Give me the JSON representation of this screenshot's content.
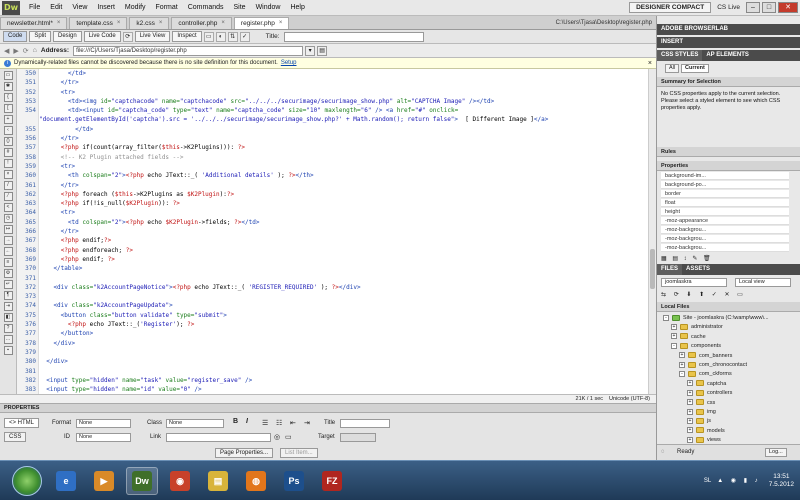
{
  "app": {
    "logo": "Dw",
    "menus": [
      "File",
      "Edit",
      "View",
      "Insert",
      "Modify",
      "Format",
      "Commands",
      "Site",
      "Window",
      "Help"
    ],
    "workspace": "DESIGNER COMPACT",
    "cs_live": "CS Live",
    "win_min": "–",
    "win_max": "□",
    "win_close": "✕"
  },
  "tabs": [
    {
      "label": "newsletter.html*",
      "active": false
    },
    {
      "label": "template.css",
      "active": false
    },
    {
      "label": "k2.css",
      "active": false
    },
    {
      "label": "controller.php",
      "active": false
    },
    {
      "label": "register.php",
      "active": true
    }
  ],
  "doc_path": "C:\\Users\\Tjasa\\Desktop\\register.php",
  "viewbar": {
    "code": "Code",
    "split": "Split",
    "design": "Design",
    "live_code": "Live Code",
    "live_view": "Live View",
    "inspect": "Inspect",
    "title_label": "Title:"
  },
  "address": {
    "label": "Address:",
    "value": "file:///C|/Users/Tjasa/Desktop/register.php"
  },
  "infobar": {
    "text": "Dynamically-related files cannot be discovered because there is no site definition for this document.",
    "link": "Setup"
  },
  "code_lines": [
    {
      "n": "350",
      "t": "<span class=\"k\">        &lt;/td&gt;</span>"
    },
    {
      "n": "351",
      "t": "<span class=\"k\">      &lt;/tr&gt;</span>"
    },
    {
      "n": "352",
      "t": "<span class=\"k\">      &lt;tr&gt;</span>"
    },
    {
      "n": "353",
      "t": "<span class=\"k\">        &lt;td&gt;&lt;img</span> <span class=\"a\">id=</span><span class=\"s\">\"captchacode\"</span> <span class=\"a\">name=</span><span class=\"s\">\"captchacode\"</span> <span class=\"a\">src=</span><span class=\"s\">\"../../../securimage/securimage_show.php\"</span> <span class=\"a\">alt=</span><span class=\"s\">\"CAPTCHA Image\"</span> <span class=\"k\">/&gt;&lt;/td&gt;</span>"
    },
    {
      "n": "354",
      "t": "<span class=\"k\">        &lt;td&gt;&lt;input</span> <span class=\"a\">id=</span><span class=\"s\">\"captcha_code\"</span> <span class=\"a\">type=</span><span class=\"s\">\"text\"</span> <span class=\"a\">name=</span><span class=\"s\">\"captcha_code\"</span> <span class=\"a\">size=</span><span class=\"s\">\"10\"</span> <span class=\"a\">maxlength=</span><span class=\"s\">\"6\"</span> <span class=\"k\">/&gt; &lt;a</span> <span class=\"a\">href=</span><span class=\"s\">\"#\"</span> <span class=\"a\">onclick=</span>\n<span class=\"s\">\"document.getElementById('captcha').src = '../../../securimage/securimage_show.php?' + Math.random(); return false\"</span><span class=\"k\">&gt;</span>  [ Different Image ]<span class=\"k\">&lt;/a&gt;</span>",
      "wrap": true
    },
    {
      "n": "355",
      "t": "<span class=\"k\">          &lt;/td&gt;</span>"
    },
    {
      "n": "356",
      "t": "<span class=\"k\">      &lt;/tr&gt;</span>"
    },
    {
      "n": "357",
      "t": "      <span class=\"p\">&lt;?php</span> if(count(array_filter(<span class=\"p\">$this</span>-&gt;K2Plugins))): <span class=\"p\">?&gt;</span>"
    },
    {
      "n": "358",
      "t": "<span class=\"c\">      &lt;!-- K2 Plugin attached fields --&gt;</span>"
    },
    {
      "n": "359",
      "t": "<span class=\"k\">      &lt;tr&gt;</span>"
    },
    {
      "n": "360",
      "t": "<span class=\"k\">        &lt;th</span> <span class=\"a\">colspan=</span><span class=\"s\">\"2\"</span><span class=\"k\">&gt;</span><span class=\"p\">&lt;?php</span> echo JText::_( <span class=\"s\">'Additional details'</span> ); <span class=\"p\">?&gt;</span><span class=\"k\">&lt;/th&gt;</span>"
    },
    {
      "n": "361",
      "t": "<span class=\"k\">      &lt;/tr&gt;</span>"
    },
    {
      "n": "362",
      "t": "      <span class=\"p\">&lt;?php</span> foreach (<span class=\"p\">$this</span>-&gt;K2Plugins as <span class=\"p\">$K2Plugin</span>):<span class=\"p\">?&gt;</span>"
    },
    {
      "n": "363",
      "t": "      <span class=\"p\">&lt;?php</span> if(!is_null(<span class=\"p\">$K2Plugin</span>)): <span class=\"p\">?&gt;</span>"
    },
    {
      "n": "364",
      "t": "<span class=\"k\">      &lt;tr&gt;</span>"
    },
    {
      "n": "365",
      "t": "<span class=\"k\">        &lt;td</span> <span class=\"a\">colspan=</span><span class=\"s\">\"2\"</span><span class=\"k\">&gt;</span><span class=\"p\">&lt;?php</span> echo <span class=\"p\">$K2Plugin</span>-&gt;fields; <span class=\"p\">?&gt;</span><span class=\"k\">&lt;/td&gt;</span>"
    },
    {
      "n": "366",
      "t": "<span class=\"k\">      &lt;/tr&gt;</span>"
    },
    {
      "n": "367",
      "t": "      <span class=\"p\">&lt;?php</span> endif;<span class=\"p\">?&gt;</span>"
    },
    {
      "n": "368",
      "t": "      <span class=\"p\">&lt;?php</span> endforeach; <span class=\"p\">?&gt;</span>"
    },
    {
      "n": "369",
      "t": "      <span class=\"p\">&lt;?php</span> endif; <span class=\"p\">?&gt;</span>"
    },
    {
      "n": "370",
      "t": "<span class=\"k\">    &lt;/table&gt;</span>"
    },
    {
      "n": "371",
      "t": ""
    },
    {
      "n": "372",
      "t": "<span class=\"k\">    &lt;div</span> <span class=\"a\">class=</span><span class=\"s\">\"k2AccountPageNotice\"</span><span class=\"k\">&gt;</span><span class=\"p\">&lt;?php</span> echo JText::_( <span class=\"s\">'REGISTER_REQUIRED'</span> ); <span class=\"p\">?&gt;</span><span class=\"k\">&lt;/div&gt;</span>"
    },
    {
      "n": "373",
      "t": ""
    },
    {
      "n": "374",
      "t": "<span class=\"k\">    &lt;div</span> <span class=\"a\">class=</span><span class=\"s\">\"k2AccountPageUpdate\"</span><span class=\"k\">&gt;</span>"
    },
    {
      "n": "375",
      "t": "<span class=\"k\">      &lt;button</span> <span class=\"a\">class=</span><span class=\"s\">\"button validate\"</span> <span class=\"a\">type=</span><span class=\"s\">\"submit\"</span><span class=\"k\">&gt;</span>"
    },
    {
      "n": "376",
      "t": "        <span class=\"p\">&lt;?php</span> echo JText::_(<span class=\"s\">'Register'</span>); <span class=\"p\">?&gt;</span>"
    },
    {
      "n": "377",
      "t": "<span class=\"k\">      &lt;/button&gt;</span>"
    },
    {
      "n": "378",
      "t": "<span class=\"k\">    &lt;/div&gt;</span>"
    },
    {
      "n": "379",
      "t": ""
    },
    {
      "n": "380",
      "t": "<span class=\"k\">  &lt;/div&gt;</span>"
    },
    {
      "n": "381",
      "t": ""
    },
    {
      "n": "382",
      "t": "<span class=\"k\">  &lt;input</span> <span class=\"a\">type=</span><span class=\"s\">\"hidden\"</span> <span class=\"a\">name=</span><span class=\"s\">\"task\"</span> <span class=\"a\">value=</span><span class=\"s\">\"register_save\"</span> <span class=\"k\">/&gt;</span>"
    },
    {
      "n": "383",
      "t": "<span class=\"k\">  &lt;input</span> <span class=\"a\">type=</span><span class=\"s\">\"hidden\"</span> <span class=\"a\">name=</span><span class=\"s\">\"id\"</span> <span class=\"a\">value=</span><span class=\"s\">\"0\"</span> <span class=\"k\">/&gt;</span>"
    }
  ],
  "status": {
    "size": "21K / 1 sec",
    "encoding": "Unicode (UTF-8)"
  },
  "properties": {
    "header": "PROPERTIES",
    "html_btn": "<> HTML",
    "css_btn": "CSS",
    "format_label": "Format",
    "format_value": "None",
    "class_label": "Class",
    "class_value": "None",
    "id_label": "ID",
    "id_value": "None",
    "link_label": "Link",
    "title_label": "Title",
    "target_label": "Target",
    "bold": "B",
    "italic": "I",
    "page_props": "Page Properties...",
    "list_item": "List Item..."
  },
  "right": {
    "browserlab": "ADOBE BROWSERLAB",
    "insert": "INSERT",
    "css_styles": "CSS STYLES",
    "ap_elements": "AP ELEMENTS",
    "all": "All",
    "current": "Current",
    "summary_title": "Summary for Selection",
    "summary_text": "No CSS properties apply to the current selection.  Please select a styled element to see which CSS properties apply.",
    "rules": "Rules",
    "properties": "Properties",
    "prop_rows": [
      "background-im...",
      "background-po...",
      "border",
      "float",
      "height",
      "-moz-appearance",
      "-moz-backgrou...",
      "-moz-backgrou...",
      "-moz-backgrou..."
    ],
    "files_tab": "FILES",
    "assets_tab": "ASSETS",
    "site_select": "joomlaskra",
    "view_select": "Local view",
    "local_files": "Local Files",
    "tree": [
      {
        "label": "Site - joomlaskra (C:\\wamp\\www\\...",
        "indent": 0,
        "pm": "-",
        "green": true
      },
      {
        "label": "administrator",
        "indent": 1,
        "pm": "+"
      },
      {
        "label": "cache",
        "indent": 1,
        "pm": "+"
      },
      {
        "label": "components",
        "indent": 1,
        "pm": "-"
      },
      {
        "label": "com_banners",
        "indent": 2,
        "pm": "+"
      },
      {
        "label": "com_chronocontact",
        "indent": 2,
        "pm": "+"
      },
      {
        "label": "com_ckforms",
        "indent": 2,
        "pm": "-"
      },
      {
        "label": "captcha",
        "indent": 3,
        "pm": "+"
      },
      {
        "label": "controllers",
        "indent": 3,
        "pm": "+"
      },
      {
        "label": "css",
        "indent": 3,
        "pm": "+"
      },
      {
        "label": "img",
        "indent": 3,
        "pm": "+"
      },
      {
        "label": "js",
        "indent": 3,
        "pm": "+"
      },
      {
        "label": "models",
        "indent": 3,
        "pm": "+"
      },
      {
        "label": "views",
        "indent": 3,
        "pm": "+"
      }
    ],
    "ready": "Ready",
    "log": "Log..."
  },
  "taskbar": {
    "apps": [
      {
        "label": "e",
        "color": "#2f6fc4",
        "active": false
      },
      {
        "label": "▶",
        "color": "#d98a28",
        "active": false
      },
      {
        "label": "Dw",
        "color": "#3f6f2a",
        "active": true
      },
      {
        "label": "◉",
        "color": "#c8412a",
        "active": false
      },
      {
        "label": "▤",
        "color": "#d8b43a",
        "active": false
      },
      {
        "label": "◍",
        "color": "#e2761b",
        "active": false
      },
      {
        "label": "Ps",
        "color": "#1d4f8c",
        "active": false
      },
      {
        "label": "FZ",
        "color": "#b0261f",
        "active": false
      }
    ],
    "lang": "SL",
    "time": "13:51",
    "date": "7.5.2012"
  }
}
